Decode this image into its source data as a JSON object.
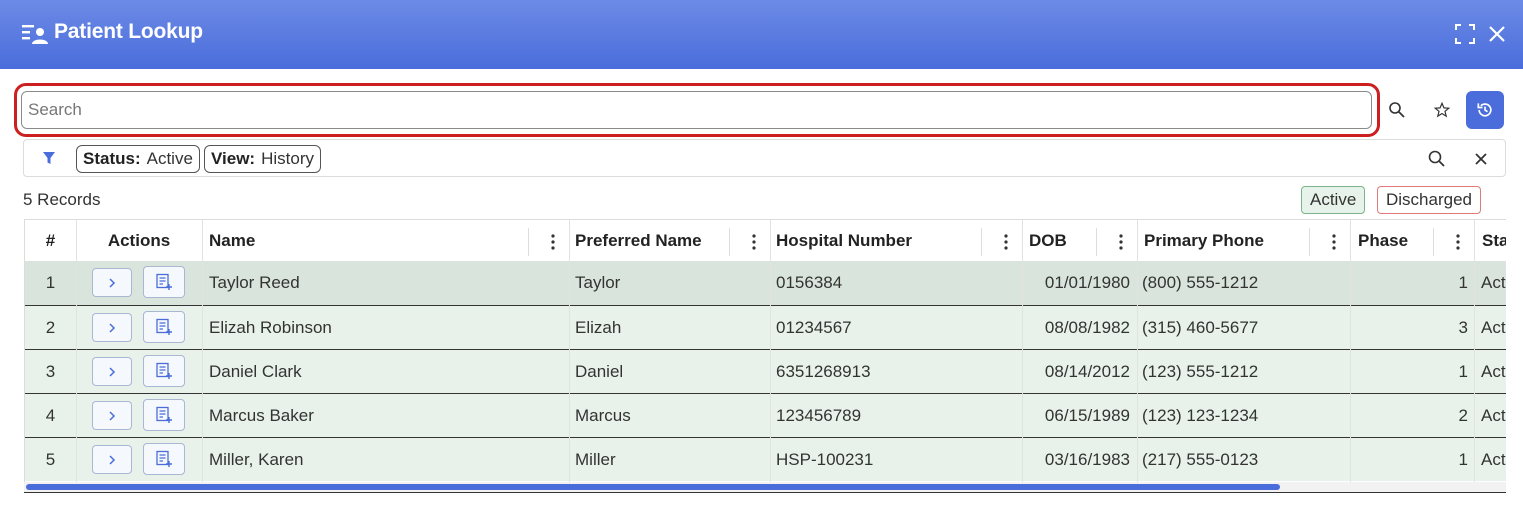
{
  "window": {
    "title": "Patient Lookup",
    "icons": {
      "app": "person-list-icon",
      "expand": "fullscreen-icon",
      "close": "close-icon"
    }
  },
  "search": {
    "placeholder": "Search",
    "value": "",
    "highlight_color": "#cc1f1f"
  },
  "toolbar": {
    "icons": [
      "search-icon",
      "star-icon",
      "history-icon"
    ],
    "history_active_color": "#4a6ddb"
  },
  "filters": {
    "chips": [
      {
        "key": "Status:",
        "value": "Active"
      },
      {
        "key": "View:",
        "value": "History"
      }
    ]
  },
  "records": {
    "count_label": "5 Records",
    "legend": {
      "active": "Active",
      "discharged": "Discharged"
    }
  },
  "table": {
    "columns": [
      "#",
      "Actions",
      "Name",
      "Preferred Name",
      "Hospital Number",
      "DOB",
      "Primary Phone",
      "Phase",
      "Sta"
    ],
    "rows": [
      {
        "num": "1",
        "name": "Taylor Reed",
        "preferred": "Taylor",
        "hospital": "0156384",
        "dob": "01/01/1980",
        "phone": "(800) 555-1212",
        "phase": "1",
        "status": "Act"
      },
      {
        "num": "2",
        "name": "Elizah Robinson",
        "preferred": "Elizah",
        "hospital": "01234567",
        "dob": "08/08/1982",
        "phone": "(315) 460-5677",
        "phase": "3",
        "status": "Act"
      },
      {
        "num": "3",
        "name": "Daniel Clark",
        "preferred": "Daniel",
        "hospital": "6351268913",
        "dob": "08/14/2012",
        "phone": "(123) 555-1212",
        "phase": "1",
        "status": "Act"
      },
      {
        "num": "4",
        "name": "Marcus Baker",
        "preferred": "Marcus",
        "hospital": "123456789",
        "dob": "06/15/1989",
        "phone": "(123) 123-1234",
        "phase": "2",
        "status": "Act"
      },
      {
        "num": "5",
        "name": "Miller, Karen",
        "preferred": "Miller",
        "hospital": "HSP-100231",
        "dob": "03/16/1983",
        "phone": "(217) 555-0123",
        "phase": "1",
        "status": "Act"
      }
    ]
  },
  "colors": {
    "accent": "#4a6ddb",
    "row_bg": "#e8f2ea",
    "row_selected_bg": "#d9e5dc"
  }
}
